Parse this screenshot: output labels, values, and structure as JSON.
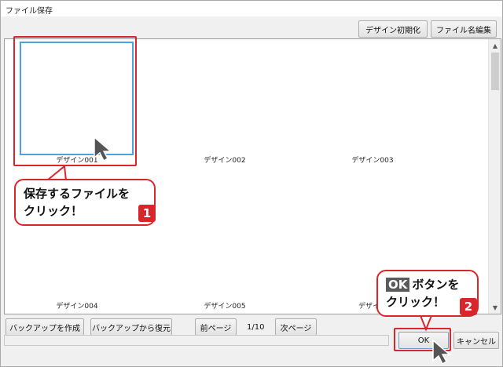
{
  "window": {
    "title": "ファイル保存"
  },
  "toolbar": {
    "design_init_label": "デザイン初期化",
    "file_name_edit_label": "ファイル名編集"
  },
  "grid": {
    "items": [
      {
        "caption": "デザイン001"
      },
      {
        "caption": "デザイン002"
      },
      {
        "caption": "デザイン003"
      },
      {
        "caption": "デザイン004"
      },
      {
        "caption": "デザイン005"
      },
      {
        "caption": "デザイン"
      }
    ]
  },
  "bottom": {
    "create_backup_label": "バックアップを作成",
    "restore_backup_label": "バックアップから復元",
    "prev_page_label": "前ページ",
    "page_indicator": "1/10",
    "next_page_label": "次ページ",
    "ok_label": "OK",
    "cancel_label": "キャンセル"
  },
  "annotations": {
    "callout1": {
      "line1": "保存するファイルを",
      "line2": "クリック！",
      "number": "1"
    },
    "callout2": {
      "ok_word": "OK",
      "line1_rest": "ボタンを",
      "line2": "クリック！",
      "number": "2"
    }
  },
  "colors": {
    "accent_red": "#d9262c",
    "selection_blue": "#4aa3df"
  },
  "icons": {
    "cursor": "mouse-cursor-icon",
    "scroll_up": "chevron-up-icon",
    "scroll_down": "chevron-down-icon"
  }
}
